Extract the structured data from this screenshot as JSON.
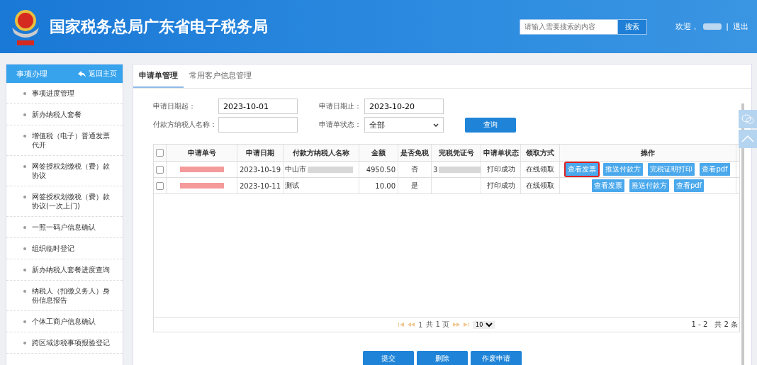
{
  "header": {
    "title": "国家税务总局广东省电子税务局",
    "search": {
      "placeholder": "请输入需要搜索的内容",
      "button": "搜索"
    },
    "welcome": "欢迎，",
    "separator": "|",
    "logout": "退出"
  },
  "sidebar": {
    "title": "事项办理",
    "back": "返回主页",
    "items": [
      {
        "label": "事项进度管理"
      },
      {
        "label": "新办纳税人套餐"
      },
      {
        "label": "增值税（电子）普通发票代开"
      },
      {
        "label": "网签授权划缴税（费）款协议"
      },
      {
        "label": "网签授权划缴税（费）款协议(一次上门)"
      },
      {
        "label": "一照一码户信息确认"
      },
      {
        "label": "组织临时登记"
      },
      {
        "label": "新办纳税人套餐进度查询"
      },
      {
        "label": "纳税人（扣缴义务人）身份信息报告"
      },
      {
        "label": "个体工商户信息确认"
      },
      {
        "label": "跨区域涉税事项报验登记"
      }
    ]
  },
  "tabs": [
    {
      "label": "申请单管理",
      "selected": true
    },
    {
      "label": "常用客户信息管理",
      "selected": false
    }
  ],
  "filters": {
    "start_label": "申请日期起：",
    "start_value": "2023-10-01",
    "end_label": "申请日期止：",
    "end_value": "2023-10-20",
    "payer_label": "付款方纳税人名称：",
    "status_label": "申请单状态：",
    "status_value": "全部",
    "query": "查询"
  },
  "table": {
    "all_checked": false,
    "columns": [
      "申请单号",
      "申请日期",
      "付款方纳税人名称",
      "金额",
      "是否免税",
      "完税凭证号",
      "申请单状态",
      "领取方式",
      "操作"
    ],
    "rows": [
      {
        "checked": false,
        "date": "2023-10-19",
        "payer": "中山市",
        "amount": "4950.50",
        "exempt": "否",
        "cert": "3",
        "status": "打印成功",
        "method": "在线领取",
        "actions": [
          {
            "label": "查看发票",
            "outlined": true
          },
          {
            "label": "推送付款方",
            "outlined": false
          },
          {
            "label": "完税证明打印",
            "outlined": false
          },
          {
            "label": "查看pdf",
            "outlined": false
          }
        ]
      },
      {
        "checked": false,
        "date": "2023-10-11",
        "payer": "测试",
        "amount": "10.00",
        "exempt": "是",
        "cert": "",
        "status": "打印成功",
        "method": "在线领取",
        "actions": [
          {
            "label": "查看发票",
            "outlined": false
          },
          {
            "label": "推送付款方",
            "outlined": false
          },
          {
            "label": "查看pdf",
            "outlined": false
          }
        ]
      }
    ]
  },
  "pagination": {
    "page": "1",
    "pages": "共 1 页",
    "page_size": "10",
    "summary": "1 - 2　共 2 条"
  },
  "buttons": [
    "提交",
    "删除",
    "作废申请"
  ]
}
